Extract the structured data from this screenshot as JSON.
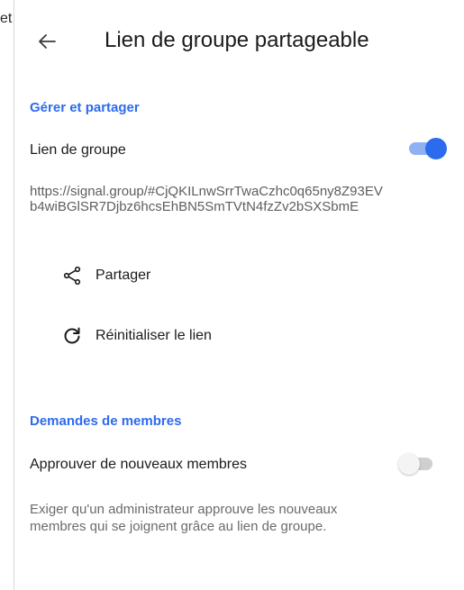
{
  "edge_text": "et",
  "header": {
    "back_icon": "arrow-left-icon",
    "title": "Lien de groupe partageable"
  },
  "manage_section": {
    "title": "Gérer et partager",
    "group_link": {
      "label": "Lien de groupe",
      "enabled": true
    },
    "link_url": "https://signal.group/#CjQKILnwSrrTwaCzhc0q65ny8Z93EVb4wiBGlSR7Djbz6hcsEhBN5SmTVtN4fzZv2bSXSbmE",
    "actions": [
      {
        "icon": "share-icon",
        "label": "Partager"
      },
      {
        "icon": "refresh-icon",
        "label": "Réinitialiser le lien"
      }
    ]
  },
  "requests_section": {
    "title": "Demandes de membres",
    "approve": {
      "label": "Approuver de nouveaux membres",
      "enabled": false
    },
    "description": "Exiger qu'un administrateur approuve les nouveaux membres qui se joignent grâce au lien de groupe."
  },
  "colors": {
    "accent": "#2c6bed",
    "toggle_on_track": "#8fb1f3",
    "toggle_off_track": "#cfcfcf"
  }
}
